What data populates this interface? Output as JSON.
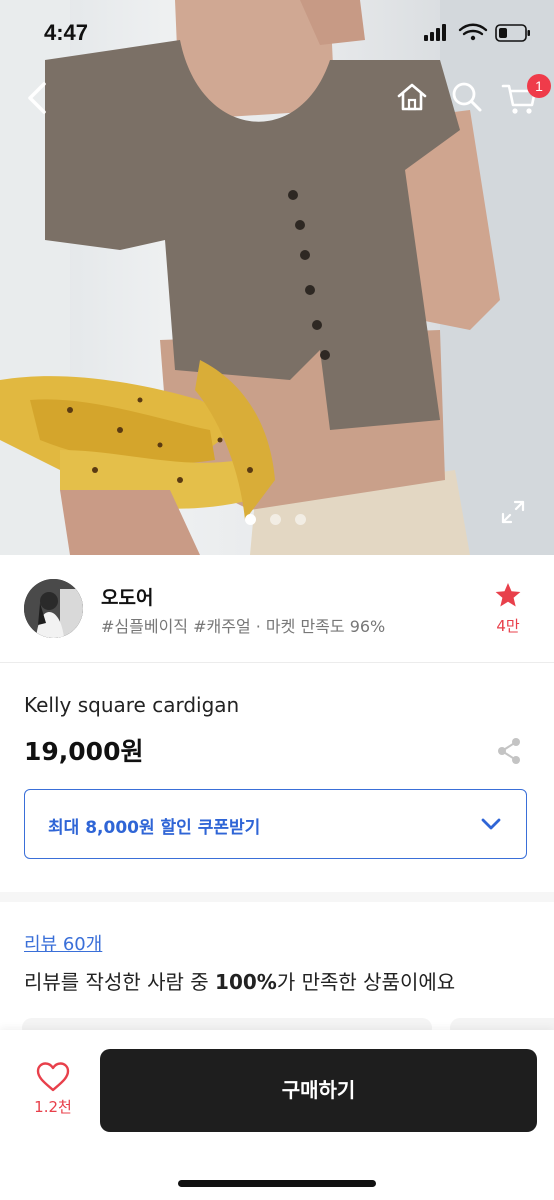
{
  "status_bar": {
    "time": "4:47"
  },
  "nav": {
    "cart_badge": "1",
    "icons": [
      "chevron-left-icon",
      "home-icon",
      "search-icon",
      "cart-icon"
    ]
  },
  "gallery": {
    "page_count": 3,
    "current_page": 1
  },
  "seller": {
    "name": "오도어",
    "tags": "#심플베이직 #캐주얼 · 마켓 만족도 96%",
    "favorite_count": "4만"
  },
  "product": {
    "name": "Kelly square cardigan",
    "price": "19,000원"
  },
  "coupon": {
    "label": "최대 8,000원 할인 쿠폰받기"
  },
  "reviews": {
    "link": "리뷰 60개",
    "summary_prefix": "리뷰를 작성한 사람 중 ",
    "summary_highlight": "100%",
    "summary_suffix": "가 만족한 상품이에요"
  },
  "bottom_bar": {
    "like_count": "1.2천",
    "buy_label": "구매하기"
  },
  "colors": {
    "accent_blue": "#3a6fd8",
    "accent_red": "#ef3b4a",
    "buy_button": "#1e1e1e"
  }
}
